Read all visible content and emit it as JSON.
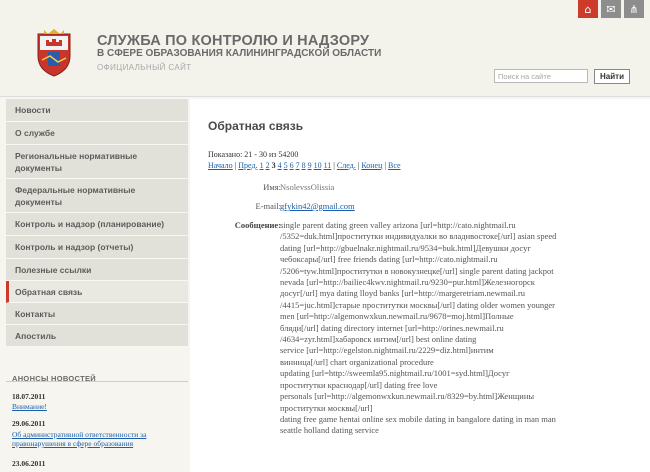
{
  "header": {
    "title_line1": "СЛУЖБА ПО КОНТРОЛЮ И НАДЗОРУ",
    "title_line2": "В СФЕРЕ ОБРАЗОВАНИЯ КАЛИНИНГРАДСКОЙ ОБЛАСТИ",
    "subtitle": "ОФИЦИАЛЬНЫЙ САЙТ",
    "search_placeholder": "Поиск на сайте",
    "search_button": "Найти",
    "icons": [
      "home-icon",
      "mail-icon",
      "sitemap-icon"
    ]
  },
  "sidebar": {
    "items": [
      {
        "label": "Новости"
      },
      {
        "label": "О службе"
      },
      {
        "label": "Региональные нормативные документы"
      },
      {
        "label": "Федеральные нормативные документы"
      },
      {
        "label": "Контроль и надзор (планирование)"
      },
      {
        "label": "Контроль и надзор (отчеты)"
      },
      {
        "label": "Полезные ссылки"
      },
      {
        "label": "Обратная связь"
      },
      {
        "label": "Контакты"
      },
      {
        "label": "Апостиль"
      }
    ],
    "active_index": 7
  },
  "news": {
    "heading": "АНОНСЫ НОВОСТЕЙ",
    "items": [
      {
        "date": "18.07.2011",
        "link": "Внимание!"
      },
      {
        "date": "29.06.2011",
        "link": "Об административной ответственности за правонарушения в сфере образования"
      },
      {
        "date": "23.06.2011",
        "link": ""
      }
    ]
  },
  "main": {
    "title": "Обратная связь",
    "pager_info": "Показано: 21 - 30 из 54200",
    "pager": {
      "first": "Начало",
      "prev": "Пред.",
      "pages": [
        "1",
        "2",
        "3",
        "4",
        "5",
        "6",
        "7",
        "8",
        "9",
        "10",
        "11"
      ],
      "current": "3",
      "next": "След.",
      "last": "Конец",
      "all": "Все"
    },
    "fields": {
      "name_label": "Имя:",
      "name_value": "NsolevssOlissia",
      "email_label": "E-mail:",
      "email_value": "gfykin42@gmail.com",
      "message_label": "Сообщение:",
      "message_value": "single parent dating green valley arizona  [url=http://cato.nightmail.ru\n/5352=duk.html]проститутки индивидуалки во владивостоке[/url]  asian speed\ndating  [url=http://gbuelnakr.nightmail.ru/9534=buk.html]Девушки досуг\nчебоксары[/url]  free friends dating  [url=http://cato.nightmail.ru\n/5206=tyw.html]проститутки в новокузнецке[/url]  single parent dating jackpot\nnevada  [url=http://bailiec4kwv.nightmail.ru/9230=pur.html]Железногорск\nдосуг[/url]  mya dating lloyd banks  [url=http://margeretriam.newmail.ru\n/4415=juc.html]старые проститутки москвы[/url]  dating older women younger\nmen  [url=http://algemonwxkun.newmail.ru/9678=moj.html]Полные\nбляди[/url]  dating directory internet  [url=http://orines.newmail.ru\n/4634=zyr.html]хабаровск интим[/url]  best online dating\nservice  [url=http://egelston.nightmail.ru/2229=diz.html]интим\nвинница[/url]  chart organizational procedure\nupdating  [url=http://sweemla95.nightmail.ru/1001=syd.html]Досуг\nпроститутки краснодар[/url]  dating free love\npersonals  [url=http://algemonwxkun.newmail.ru/8329=by.html]Женщины\nпроститутки москвы[/url]\ndating free game hentai online sex mobile dating in bangalore dating in man man\nseattle holland dating service"
    }
  },
  "colors": {
    "accent": "#cc3b2a",
    "link": "#1a5fad",
    "nav_bg": "#e2e1d9"
  }
}
